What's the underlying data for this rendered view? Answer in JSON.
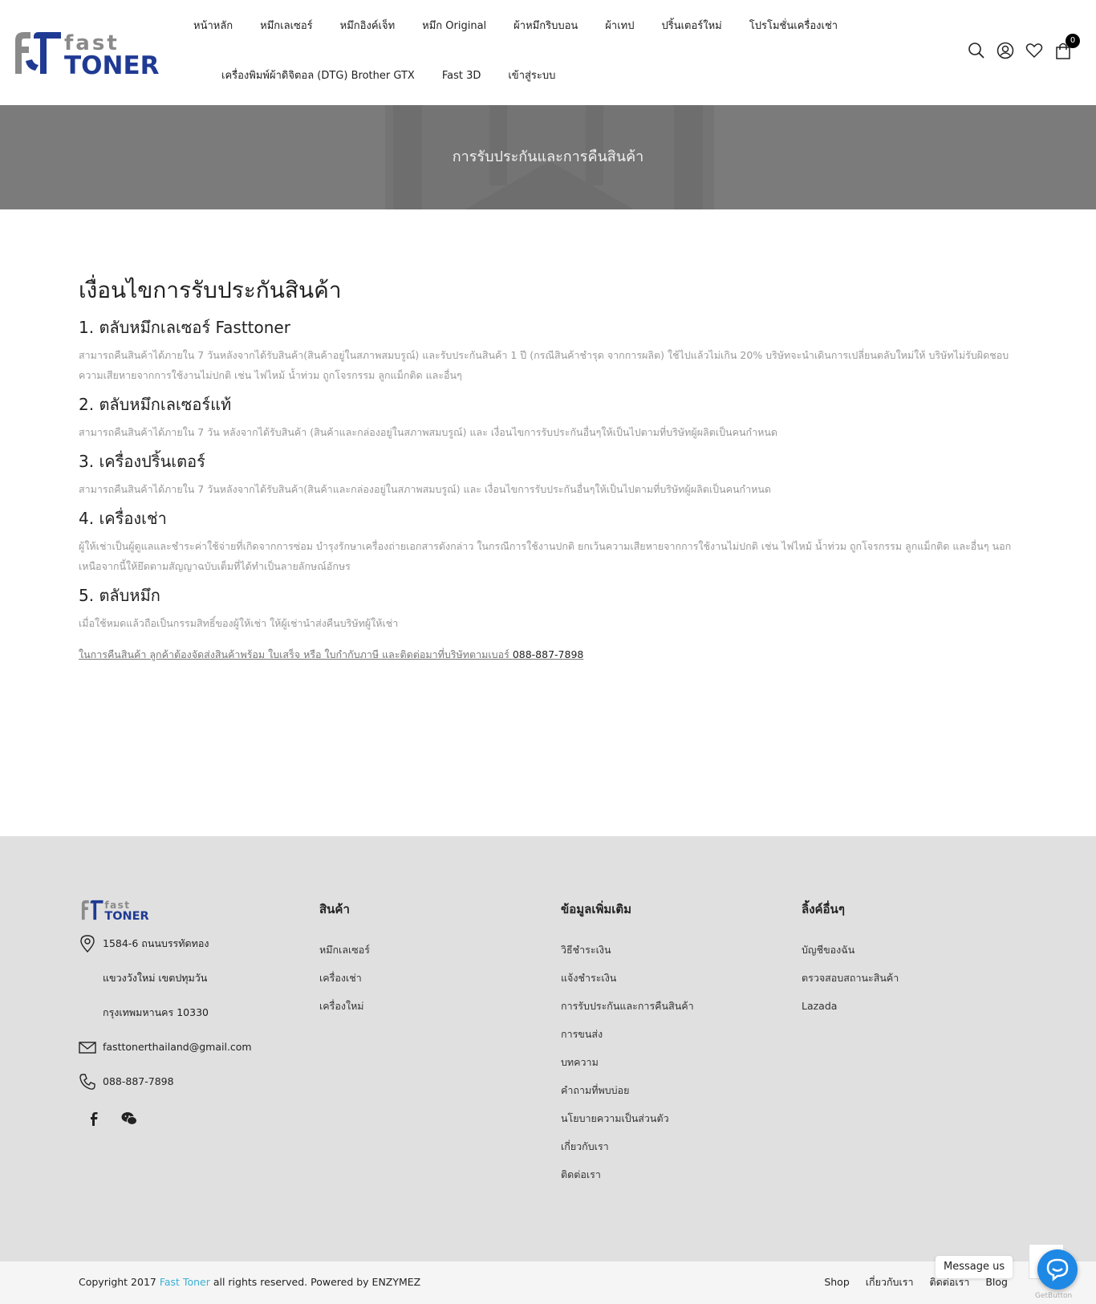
{
  "header": {
    "nav_row1": [
      "หน้าหลัก",
      "หมึกเลเซอร์",
      "หมึกอิงค์เจ็ท",
      "หมึก Original",
      "ผ้าหมึกริบบอน",
      "ผ้าเทป",
      "ปริ้นเตอร์ใหม่",
      "โปรโมชั่นเครื่องเช่า"
    ],
    "nav_row2": [
      "เครื่องพิมพ์ผ้าดิจิตอล (DTG) Brother GTX",
      "Fast 3D",
      "เข้าสู่ระบบ"
    ],
    "cart_count": "0"
  },
  "banner": {
    "title": "การรับประกันและการคืนสินค้า"
  },
  "content": {
    "heading": "เงื่อนไขการรับประกันสินค้า",
    "sections": [
      {
        "title": "1. ตลับหมึกเลเซอร์ Fasttoner",
        "text": "สามารถคืนสินค้าได้ภายใน 7 วันหลังจากได้รับสินค้า(สินค้าอยู่ในสภาพสมบรูณ์) และรับประกันสินค้า 1 ปี (กรณีสินค้าชำรุด จากการผลิต) ใช้ไปแล้วไม่เกิน 20% บริษัทจะนำเดินการเปลี่ยนตลับใหม่ให้ บริษัทไม่รับผิดชอบความเสียหายจากการใช้งานไม่ปกติ เช่น ไฟไหม้ น้ำท่วม ถูกโจรกรรม ลูกแม็กติด และอื่นๆ"
      },
      {
        "title": "2. ตลับหมึกเลเซอร์แท้",
        "text": "สามารถคืนสินค้าได้ภายใน 7 วัน หลังจากได้รับสินค้า (สินค้าและกล่องอยู่ในสภาพสมบรูณ์) และ เงื่อนไขการรับประกันอื่นๆให้เป็นไปตามที่บริษัทผู้ผลิตเป็นคนกำหนด"
      },
      {
        "title": "3. เครื่องปริ้นเตอร์",
        "text": "สามารถคืนสินค้าได้ภายใน 7 วันหลังจากได้รับสินค้า(สินค้าและกล่องอยู่ในสภาพสมบรูณ์) และ เงื่อนไขการรับประกันอื่นๆให้เป็นไปตามที่บริษัทผู้ผลิตเป็นคนกำหนด"
      },
      {
        "title": "4. เครื่องเช่า",
        "text": "ผู้ให้เช่าเป็นผู้ดูแลและชำระค่าใช้จ่ายที่เกิดจากการซ่อม บำรุงรักษาเครื่องถ่ายเอกสารดังกล่าว ในกรณีการใช้งานปกติ ยกเว้นความเสียหายจากการใช้งานไม่ปกติ เช่น ไฟไหม้ น้ำท่วม ถูกโจรกรรม ลูกแม็กติด และอื่นๆ นอกเหนือจากนี้ให้ยึดตามสัญญาฉบับเต็มที่ได้ทำเป็นลายลักษณ์อักษร"
      },
      {
        "title": "5. ตลับหมึก",
        "text": "เมื่อใช้หมดแล้วถือเป็นกรรมสิทธิ์ของผู้ให้เช่า ให้ผู้เช่านำส่งคืนบริษัทผู้ให้เช่า"
      }
    ],
    "return_note": "ในการคืนสินค้า ลูกค้าต้องจัดส่งสินค้าพร้อม ใบเสร็จ หรือ ใบกำกับภาษี และติดต่อมาที่บริษัทตามเบอร์ ",
    "return_phone": "088-887-7898"
  },
  "footer": {
    "address_lines": [
      "1584-6 ถนนบรรทัดทอง",
      "แขวงวังใหม่ เขตปทุมวัน",
      "กรุงเทพมหานคร 10330"
    ],
    "email": "fasttonerthailand@gmail.com",
    "phone": "088-887-7898",
    "col_products": {
      "title": "สินค้า",
      "links": [
        "หมึกเลเซอร์",
        "เครื่องเช่า",
        "เครื่องใหม่"
      ]
    },
    "col_info": {
      "title": "ข้อมูลเพิ่มเติม",
      "links": [
        "วิธีชำระเงิน",
        "แจ้งชำระเงิน",
        "การรับประกันและการคืนสินค้า",
        "การขนส่ง",
        "บทความ",
        "คำถามที่พบบ่อย",
        "นโยบายความเป็นส่วนตัว",
        "เกี่ยวกับเรา",
        "ติดต่อเรา"
      ]
    },
    "col_links": {
      "title": "ลิ้งค์อื่นๆ",
      "links": [
        "บัญชีของฉัน",
        "ตรวจสอบสถานะสินค้า",
        "Lazada"
      ]
    }
  },
  "bottom": {
    "copyright_pre": "Copyright 2017 ",
    "brand": "Fast Toner",
    "copyright_post": " all rights reserved. Powered by ENZYMEZ",
    "links": [
      "Shop",
      "เกี่ยวกับเรา",
      "ติดต่อเรา",
      "Blog"
    ]
  },
  "widgets": {
    "message_label": "Message us",
    "getbutton_label": "GetButton"
  },
  "logo": {
    "line1": "fast",
    "line2": "TONER"
  },
  "colors": {
    "logo_grey": "#8a8a8a",
    "logo_blue": "#1f3a93",
    "brand_link": "#3ab0d4",
    "banner": "#7b7b7b",
    "footer_bg": "#e0e0e0"
  }
}
